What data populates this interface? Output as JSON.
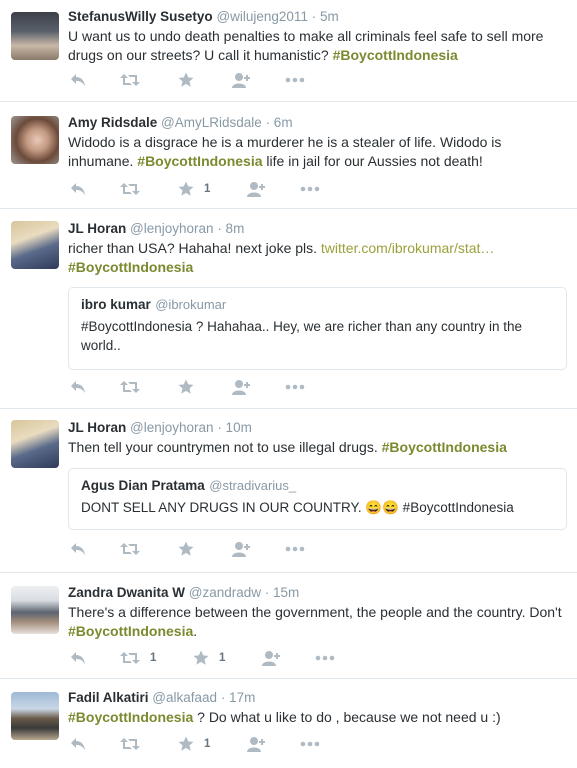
{
  "tweets": [
    {
      "name": "StefanusWilly Susetyo",
      "handle": "@wilujeng2011",
      "time": "· 5m",
      "text_a": "U want us to undo death penalties to make all criminals feel safe to sell more drugs on our streets? U call it humanistic? ",
      "tag": "#BoycottIndonesia",
      "text_b": ""
    },
    {
      "name": "Amy Ridsdale",
      "handle": "@AmyLRidsdale",
      "time": "· 6m",
      "text_a": "Widodo is a disgrace he is a murderer he is a stealer of life. Widodo is inhumane. ",
      "tag": "#BoycottIndonesia",
      "text_b": " life in jail for our Aussies not death!",
      "favorites": "1"
    },
    {
      "name": "JL Horan",
      "handle": "@lenjoyhoran",
      "time": "· 8m",
      "text_a": "richer than USA? Hahaha! next joke pls. ",
      "link": "twitter.com/ibrokumar/stat…",
      "tag": "#BoycottIndonesia",
      "quote": {
        "name": "ibro kumar",
        "handle": "@ibrokumar",
        "text": "#BoycottIndonesia ? Hahahaa.. Hey, we are richer than any country in the world.."
      }
    },
    {
      "name": "JL Horan",
      "handle": "@lenjoyhoran",
      "time": "· 10m",
      "text_a": "Then tell your countrymen not to use illegal drugs. ",
      "tag": "#BoycottIndonesia",
      "quote": {
        "name": "Agus Dian Pratama",
        "handle": "@stradivarius_",
        "text": "DONT SELL ANY DRUGS IN OUR COUNTRY. 😄😄 #BoycottIndonesia"
      }
    },
    {
      "name": "Zandra Dwanita W",
      "handle": "@zandradw",
      "time": "· 15m",
      "text_a": "There's a difference between the government, the people and the country. Don't ",
      "tag": "#BoycottIndonesia",
      "text_b": ".",
      "retweets": "1",
      "favorites": "1"
    },
    {
      "name": "Fadil Alkatiri",
      "handle": "@alkafaad",
      "time": "· 17m",
      "text_a": "",
      "tag": "#BoycottIndonesia",
      "text_b": " ? Do what u like to do , because we not need u :)",
      "favorites": "1"
    }
  ],
  "icons": [
    "reply-icon",
    "retweet-icon",
    "favorite-icon",
    "follow-icon",
    "more-icon"
  ],
  "colors": {
    "hashtag": "#7a8a2f",
    "meta": "#8899a6",
    "action": "#b0bac2",
    "divider": "#e1e8ed"
  }
}
